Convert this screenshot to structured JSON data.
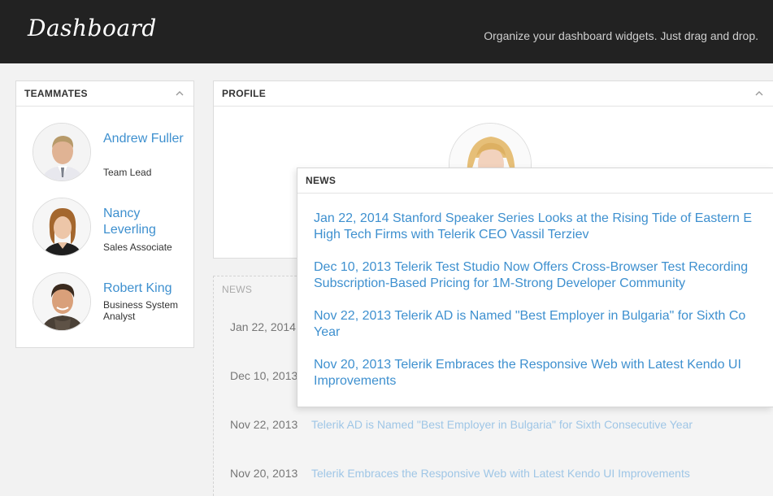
{
  "header": {
    "logo": "Dashboard",
    "tagline": "Organize your dashboard widgets. Just drag and drop."
  },
  "teammates": {
    "title": "TEAMMATES",
    "items": [
      {
        "name": "Andrew Fuller",
        "role": "Team Lead"
      },
      {
        "name": "Nancy Leverling",
        "role": "Sales Associate"
      },
      {
        "name": "Robert King",
        "role": "Business System Analyst"
      }
    ]
  },
  "profile": {
    "title": "PROFILE"
  },
  "news": {
    "title": "NEWS",
    "drag_items": [
      {
        "line1": "Jan 22, 2014 Stanford Speaker Series Looks at the Rising Tide of Eastern E",
        "line2": "High Tech Firms with Telerik CEO Vassil Terziev"
      },
      {
        "line1": "Dec 10, 2013 Telerik Test Studio Now Offers Cross-Browser Test Recording",
        "line2": "Subscription-Based Pricing for 1M-Strong Developer Community"
      },
      {
        "line1": "Nov 22, 2013 Telerik AD is Named \"Best Employer in Bulgaria\" for Sixth Co",
        "line2": "Year"
      },
      {
        "line1": "Nov 20, 2013 Telerik Embraces the Responsive Web with Latest Kendo UI",
        "line2": "Improvements"
      }
    ],
    "ghost_items": [
      {
        "date": "Jan 22, 2014",
        "text": ""
      },
      {
        "date": "Dec 10, 2013",
        "text": ""
      },
      {
        "date": "Nov 22, 2013",
        "text": "Telerik AD is Named \"Best Employer in Bulgaria\" for Sixth Consecutive Year"
      },
      {
        "date": "Nov 20, 2013",
        "text": "Telerik Embraces the Responsive Web with Latest Kendo UI Improvements"
      }
    ]
  }
}
